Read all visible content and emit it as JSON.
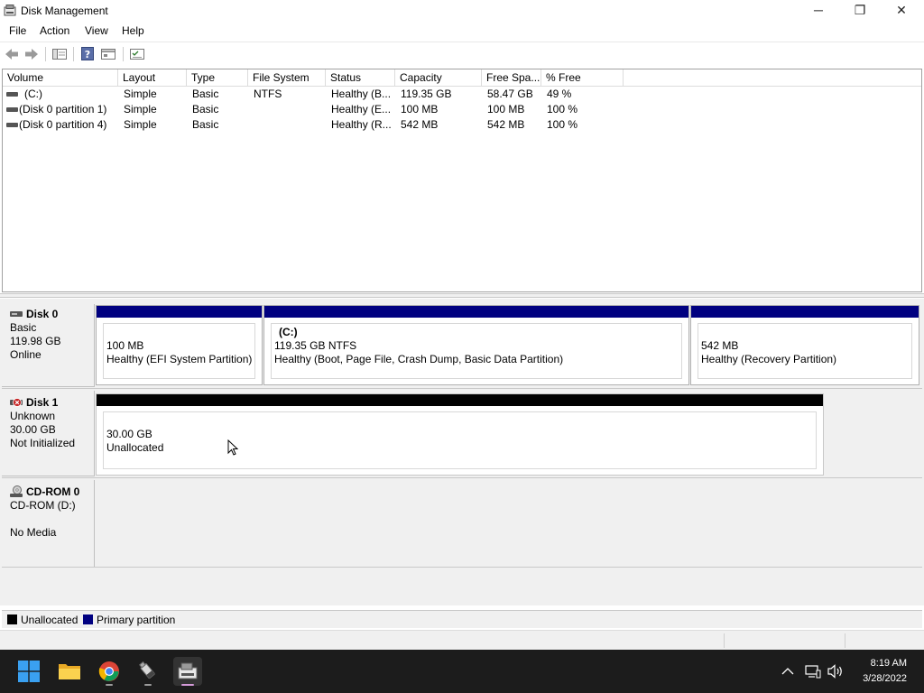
{
  "window": {
    "title": "Disk Management"
  },
  "window_controls": {
    "minimize": "─",
    "maximize": "❐",
    "close": "✕"
  },
  "menu": {
    "items": [
      "File",
      "Action",
      "View",
      "Help"
    ]
  },
  "toolbar": {
    "buttons": [
      "back-icon",
      "forward-icon",
      "disk-list-icon",
      "help-icon",
      "properties-icon",
      "console-icon"
    ]
  },
  "volume_list": {
    "columns": [
      "Volume",
      "Layout",
      "Type",
      "File System",
      "Status",
      "Capacity",
      "Free Spa...",
      "% Free"
    ],
    "rows": [
      [
        "(C:)",
        "Simple",
        "Basic",
        "NTFS",
        "Healthy (B...",
        "119.35 GB",
        "58.47 GB",
        "49 %"
      ],
      [
        "(Disk 0 partition 1)",
        "Simple",
        "Basic",
        "",
        "Healthy (E...",
        "100 MB",
        "100 MB",
        "100 %"
      ],
      [
        "(Disk 0 partition 4)",
        "Simple",
        "Basic",
        "",
        "Healthy (R...",
        "542 MB",
        "542 MB",
        "100 %"
      ]
    ]
  },
  "disks": [
    {
      "name": "Disk 0",
      "lines": [
        "Basic",
        "119.98 GB",
        "Online"
      ],
      "partitions": [
        {
          "title": "",
          "size": "100 MB",
          "status": "Healthy (EFI System Partition)",
          "kind": "primary"
        },
        {
          "title": "(C:)",
          "size": "119.35 GB NTFS",
          "status": "Healthy (Boot, Page File, Crash Dump, Basic Data Partition)",
          "kind": "primary"
        },
        {
          "title": "",
          "size": "542 MB",
          "status": "Healthy (Recovery Partition)",
          "kind": "primary"
        }
      ]
    },
    {
      "name": "Disk 1",
      "lines": [
        "Unknown",
        "30.00 GB",
        "Not Initialized"
      ],
      "partitions": [
        {
          "title": "",
          "size": "30.00 GB",
          "status": "Unallocated",
          "kind": "unallocated"
        }
      ]
    },
    {
      "name": "CD-ROM 0",
      "lines": [
        "CD-ROM (D:)",
        "",
        "No Media"
      ],
      "partitions": []
    }
  ],
  "legend": [
    {
      "label": "Unallocated",
      "color": "#000000"
    },
    {
      "label": "Primary partition",
      "color": "#000080"
    }
  ],
  "taskbar": {
    "apps": [
      "windows-start-icon",
      "file-explorer-icon",
      "chrome-icon",
      "usb-drive-icon",
      "disk-management-icon"
    ],
    "time": "8:19 AM",
    "date": "3/28/2022"
  },
  "colors": {
    "primary": "#000080",
    "unallocated": "#000000",
    "taskbar": "#1c1c1c"
  }
}
